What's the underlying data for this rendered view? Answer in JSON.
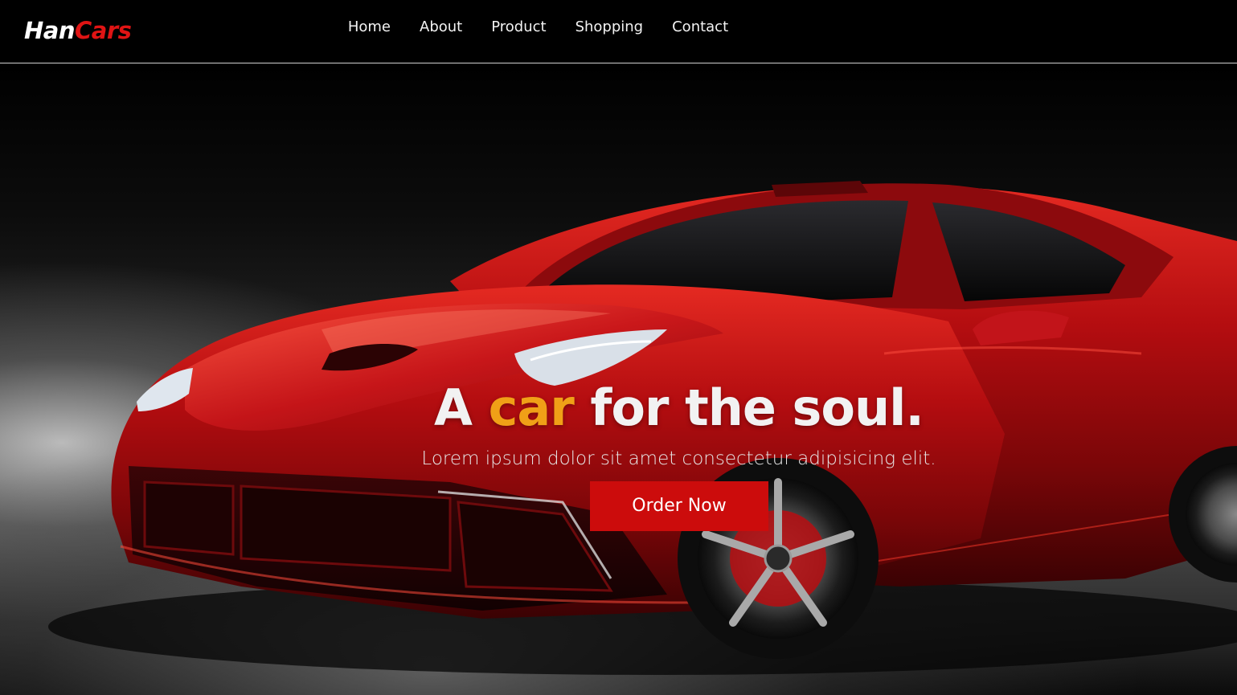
{
  "brand": {
    "part1": "Han",
    "part2": "Cars"
  },
  "nav": {
    "items": [
      {
        "label": "Home"
      },
      {
        "label": "About"
      },
      {
        "label": "Product"
      },
      {
        "label": "Shopping"
      },
      {
        "label": "Contact"
      }
    ]
  },
  "hero": {
    "headline_before": "A ",
    "headline_accent": "car",
    "headline_after": " for the soul.",
    "subtitle": "Lorem ipsum dolor sit amet consectetur adipisicing elit.",
    "cta_label": "Order Now",
    "image_subject": "red-sports-car"
  },
  "colors": {
    "brand_accent": "#e01414",
    "headline_accent": "#f0a017",
    "cta_background": "#cc0c0c",
    "nav_background": "#000000"
  }
}
